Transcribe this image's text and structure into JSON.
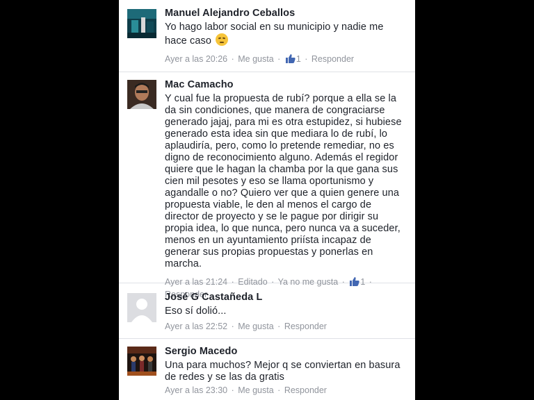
{
  "comments": [
    {
      "author": "Manuel Alejandro Ceballos",
      "text": "Yo hago labor social en su municipio y nadie me hace caso",
      "emoji": "disappointed-face-emoji",
      "time": "Ayer a las 20:26",
      "like_label": "Me gusta",
      "like_count": "1",
      "reply_label": "Responder"
    },
    {
      "author": "Mac Camacho",
      "text": "Y cual fue la propuesta de rubí? porque a ella se la da sin condiciones, que manera de congraciarse generado jajaj, para mi es otra estupidez, si hubiese generado esta idea sin que mediara lo de rubí, lo aplaudiría, pero, como lo pretende remediar, no es digno de reconocimiento alguno. Además el regidor quiere que le hagan la chamba por la que gana sus cien mil pesotes y eso se llama oportunismo y agandalle o no? Quiero ver que a quien genere una propuesta viable, le den al menos el cargo de director de proyecto y se le pague por dirigir su propia idea, lo que nunca, pero nunca va a suceder, menos en un ayuntamiento priísta incapaz de generar sus propias propuestas y ponerlas en marcha.",
      "time": "Ayer a las 21:24",
      "edited_label": "Editado",
      "unlike_label": "Ya no me gusta",
      "like_count": "1",
      "reply_label": "Responder"
    },
    {
      "author": "José G Castañeda L",
      "text": "Eso sí dolió...",
      "time": "Ayer a las 22:52",
      "like_label": "Me gusta",
      "reply_label": "Responder"
    },
    {
      "author": "Sergio Macedo",
      "text": "Una para muchos? Mejor q se conviertan en basura de redes y se las da gratis",
      "time": "Ayer a las 23:30",
      "like_label": "Me gusta",
      "reply_label": "Responder"
    }
  ],
  "separator": "·",
  "colors": {
    "author": "#1d2129",
    "meta": "#90949c",
    "like_blue": "#4267b2",
    "background": "#000000",
    "panel": "#ffffff"
  }
}
